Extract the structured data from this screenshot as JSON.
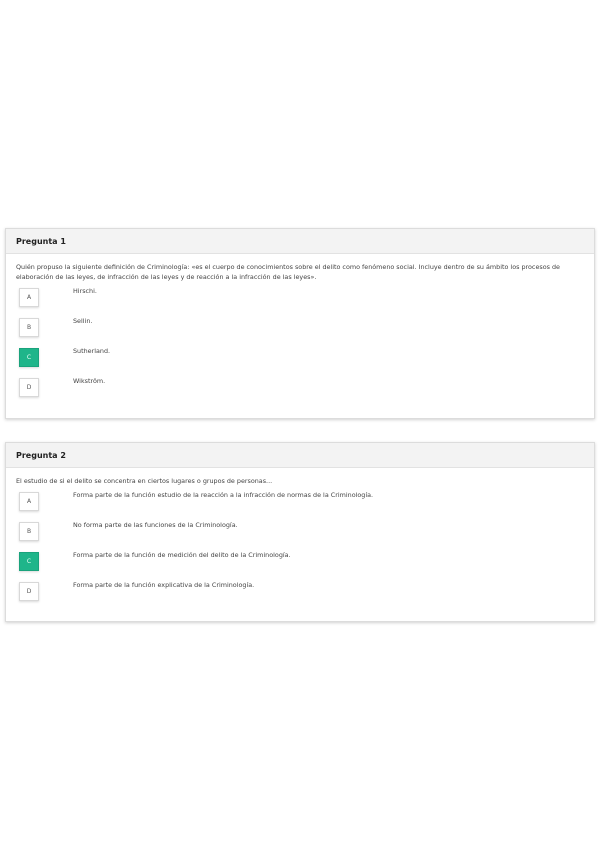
{
  "questions": [
    {
      "title": "Pregunta 1",
      "text": "Quién propuso la siguiente definición de Criminología: «es el cuerpo de conocimientos sobre el delito como fenómeno social. Incluye dentro de su ámbito los procesos de elaboración de las leyes, de infracción de las leyes y de reacción a la infracción de las leyes».",
      "selected": "C",
      "options": [
        {
          "letter": "A",
          "label": "Hirschi."
        },
        {
          "letter": "B",
          "label": "Sellin."
        },
        {
          "letter": "C",
          "label": "Sutherland."
        },
        {
          "letter": "D",
          "label": "Wikström."
        }
      ]
    },
    {
      "title": "Pregunta 2",
      "text": "El estudio de si el delito se concentra en ciertos lugares o grupos de personas...",
      "selected": "C",
      "options": [
        {
          "letter": "A",
          "label": "Forma parte de la función estudio de la reacción a la infracción de normas de la Criminología."
        },
        {
          "letter": "B",
          "label": "No forma parte de las funciones de la Criminología."
        },
        {
          "letter": "C",
          "label": "Forma parte de la función de medición del delito de la Criminología."
        },
        {
          "letter": "D",
          "label": "Forma parte de la función explicativa de la Criminología."
        }
      ]
    }
  ],
  "colors": {
    "selected": "#1fb58a"
  }
}
